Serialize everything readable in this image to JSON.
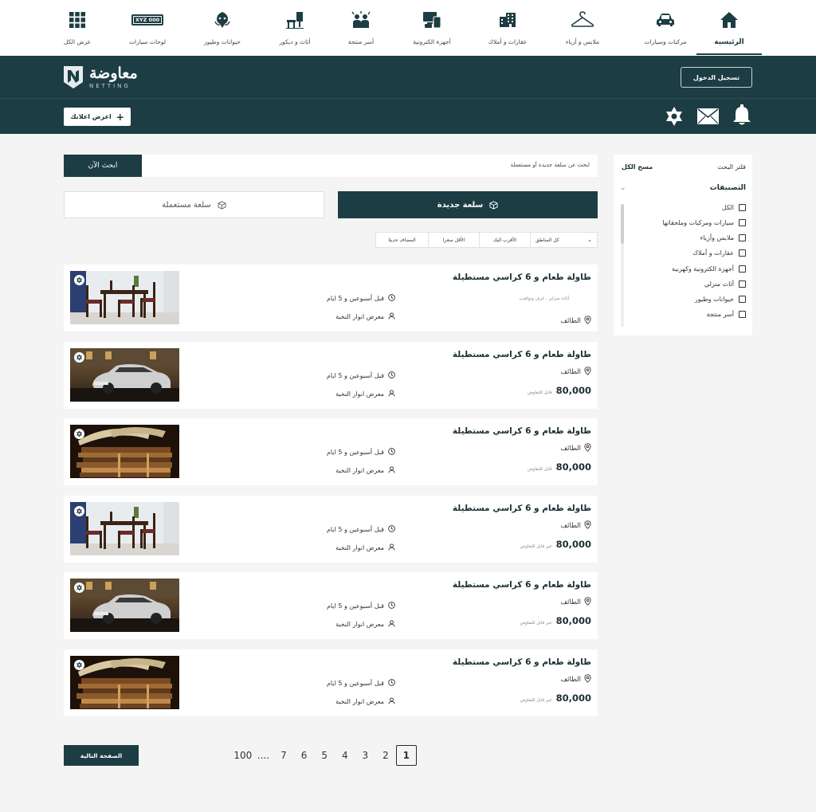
{
  "topnav": {
    "items": [
      {
        "label": "الرئيسية",
        "icon": "home-icon",
        "active": true
      },
      {
        "label": "مركبات وسيارات",
        "icon": "car-icon"
      },
      {
        "label": "ملابس و أزياء",
        "icon": "hanger-icon"
      },
      {
        "label": "عقارات و أملاك",
        "icon": "building-icon"
      },
      {
        "label": "أجهزة الكترونية",
        "icon": "devices-icon"
      },
      {
        "label": "أسر منتجة",
        "icon": "family-icon"
      },
      {
        "label": "أثاث و ديكور",
        "icon": "furniture-icon"
      },
      {
        "label": "حيوانات وطيور",
        "icon": "animals-icon"
      },
      {
        "label": "لوحات سيارات",
        "icon": "plate-icon",
        "plate_text": "XYZ 000"
      },
      {
        "label": "عرض الكل",
        "icon": "grid-icon"
      }
    ]
  },
  "header": {
    "logo_ar": "معاوضة",
    "logo_en": "NETTING",
    "login_label": "تسجيل الدخول",
    "post_ad_label": "اعرض اعلانك"
  },
  "sidebar": {
    "title": "فلتر البحث",
    "clear_all": "مسح الكل",
    "categories_title": "التصنيفات",
    "items": [
      "الكل",
      "سيارات ومركبات وملحقاتها",
      "ملابس وأزياء",
      "عقارات و أملاك",
      "أجهزة الكترونية وكهربية",
      "أثاث منزلي",
      "حيوانات وطيور",
      "أسر منتجة"
    ]
  },
  "search": {
    "placeholder": "ابحث عن سلعة جديدة أو مستعملة",
    "button_label": "ابحث الآن"
  },
  "toggle": {
    "new_label": "سلعة جديدة",
    "used_label": "سلعة مستعملة"
  },
  "filters": {
    "region": "كل المناطق",
    "nearest": "الأقرب اليك",
    "cheapest": "الأقل سعرا",
    "newest": "المضاف حديثا"
  },
  "listings": [
    {
      "title": "طاولة طعام و 6 كراسي مستطيلة",
      "subtitle": "أثاث منزلي ، غرف ونوافيب",
      "location": "الطائف",
      "price": "",
      "negotiable": "",
      "time": "قبل أسبوعين و 5 ايام",
      "seller": "معرض انوار النخبة",
      "image": "dining"
    },
    {
      "title": "طاولة طعام و 6 كراسي مستطيلة",
      "subtitle": "",
      "location": "الطائف",
      "price": "80,000",
      "negotiable": "قابل للتفاوض",
      "time": "قبل أسبوعين و 5 ايام",
      "seller": "معرض انوار النخبة",
      "image": "car"
    },
    {
      "title": "طاولة طعام و 6 كراسي مستطيلة",
      "subtitle": "",
      "location": "الطائف",
      "price": "80,000",
      "negotiable": "قابل للتفاوض",
      "time": "قبل أسبوعين و 5 ايام",
      "seller": "معرض انوار النخبة",
      "image": "books"
    },
    {
      "title": "طاولة طعام و 6 كراسي مستطيلة",
      "subtitle": "",
      "location": "الطائف",
      "price": "80,000",
      "negotiable": "غير قابل للتفاوض",
      "time": "قبل أسبوعين و 5 ايام",
      "seller": "معرض انوار النخبة",
      "image": "dining"
    },
    {
      "title": "طاولة طعام و 6 كراسي مستطيلة",
      "subtitle": "",
      "location": "الطائف",
      "price": "80,000",
      "negotiable": "غير قابل للتفاوض",
      "time": "قبل أسبوعين و 5 ايام",
      "seller": "معرض انوار النخبة",
      "image": "car"
    },
    {
      "title": "طاولة طعام و 6 كراسي مستطيلة",
      "subtitle": "",
      "location": "الطائف",
      "price": "80,000",
      "negotiable": "غير قابل للتفاوض",
      "time": "قبل أسبوعين و 5 ايام",
      "seller": "معرض انوار النخبة",
      "image": "books"
    }
  ],
  "pagination": {
    "pages": [
      "1",
      "2",
      "3",
      "4",
      "5",
      "6",
      "7",
      "....",
      "100"
    ],
    "current": "1",
    "next_label": "الصفحة التالية"
  },
  "colors": {
    "primary": "#1c3d43",
    "background": "#f4f4f4"
  }
}
